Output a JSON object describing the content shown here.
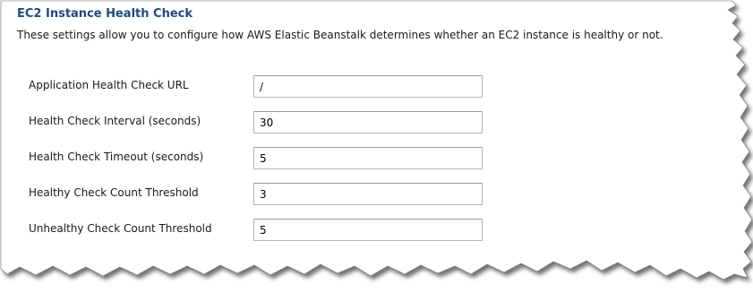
{
  "section": {
    "title": "EC2 Instance Health Check",
    "description": "These settings allow you to configure how AWS Elastic Beanstalk determines whether an EC2 instance is healthy or not."
  },
  "fields": [
    {
      "label": "Application Health Check URL",
      "value": "/"
    },
    {
      "label": "Health Check Interval (seconds)",
      "value": "30"
    },
    {
      "label": "Health Check Timeout (seconds)",
      "value": "5"
    },
    {
      "label": "Healthy Check Count Threshold",
      "value": "3"
    },
    {
      "label": "Unhealthy Check Count Threshold",
      "value": "5"
    }
  ]
}
